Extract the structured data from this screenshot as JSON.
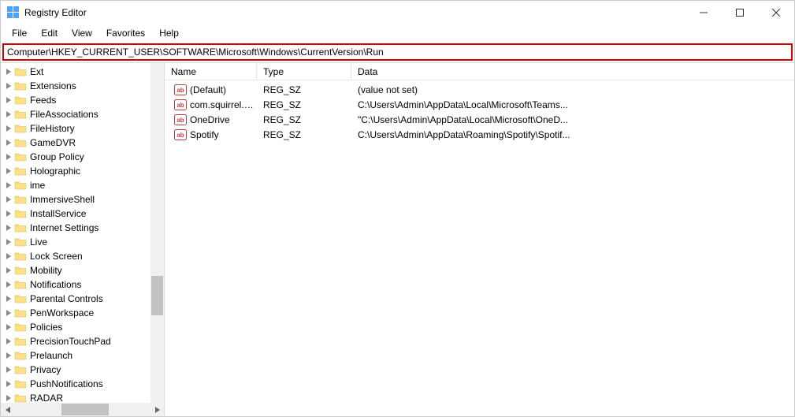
{
  "window": {
    "title": "Registry Editor"
  },
  "menu": {
    "file": "File",
    "edit": "Edit",
    "view": "View",
    "favorites": "Favorites",
    "help": "Help"
  },
  "address": "Computer\\HKEY_CURRENT_USER\\SOFTWARE\\Microsoft\\Windows\\CurrentVersion\\Run",
  "columns": {
    "name": "Name",
    "type": "Type",
    "data": "Data"
  },
  "tree": {
    "items": [
      {
        "label": "Ext"
      },
      {
        "label": "Extensions"
      },
      {
        "label": "Feeds"
      },
      {
        "label": "FileAssociations"
      },
      {
        "label": "FileHistory"
      },
      {
        "label": "GameDVR"
      },
      {
        "label": "Group Policy"
      },
      {
        "label": "Holographic"
      },
      {
        "label": "ime"
      },
      {
        "label": "ImmersiveShell"
      },
      {
        "label": "InstallService"
      },
      {
        "label": "Internet Settings"
      },
      {
        "label": "Live"
      },
      {
        "label": "Lock Screen"
      },
      {
        "label": "Mobility"
      },
      {
        "label": "Notifications"
      },
      {
        "label": "Parental Controls"
      },
      {
        "label": "PenWorkspace"
      },
      {
        "label": "Policies"
      },
      {
        "label": "PrecisionTouchPad"
      },
      {
        "label": "Prelaunch"
      },
      {
        "label": "Privacy"
      },
      {
        "label": "PushNotifications"
      },
      {
        "label": "RADAR"
      }
    ]
  },
  "values": [
    {
      "name": "(Default)",
      "type": "REG_SZ",
      "data": "(value not set)"
    },
    {
      "name": "com.squirrel.Tea...",
      "type": "REG_SZ",
      "data": "C:\\Users\\Admin\\AppData\\Local\\Microsoft\\Teams..."
    },
    {
      "name": "OneDrive",
      "type": "REG_SZ",
      "data": "\"C:\\Users\\Admin\\AppData\\Local\\Microsoft\\OneD..."
    },
    {
      "name": "Spotify",
      "type": "REG_SZ",
      "data": "C:\\Users\\Admin\\AppData\\Roaming\\Spotify\\Spotif..."
    }
  ]
}
